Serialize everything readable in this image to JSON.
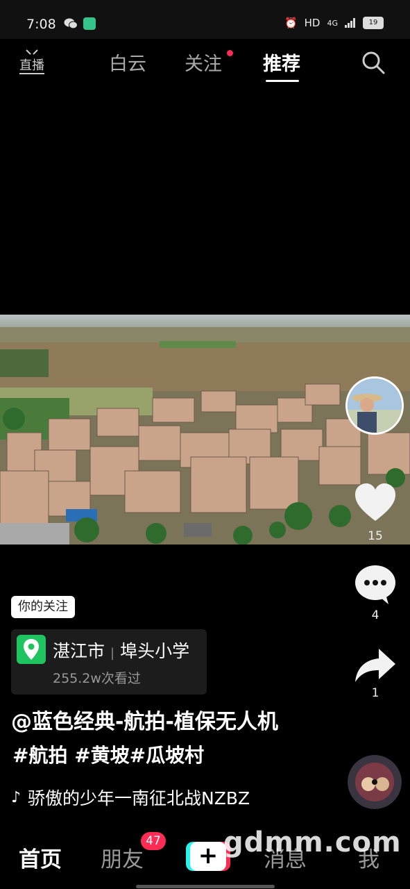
{
  "status_bar": {
    "time": "7:08",
    "network": "HD",
    "signal": "4G",
    "battery": "19"
  },
  "top_nav": {
    "live_label": "直播",
    "tabs": [
      {
        "label": "白云",
        "active": false
      },
      {
        "label": "关注",
        "active": false,
        "has_dot": true
      },
      {
        "label": "推荐",
        "active": true
      }
    ]
  },
  "right_rail": {
    "likes": "15",
    "comments": "4",
    "shares": "1"
  },
  "info": {
    "follow_tag": "你的关注",
    "location": {
      "city": "湛江市",
      "place": "埠头小学",
      "views": "255.2w次看过"
    },
    "author": "@蓝色经典-航拍-植保无人机",
    "hashtags": "#航拍 #黄坡#瓜坡村",
    "music": "骄傲的少年一南征北战NZBZ"
  },
  "bottom_nav": {
    "home": "首页",
    "friends": "朋友",
    "friends_badge": "47",
    "messages": "消息",
    "me": "我"
  },
  "watermark": "gdmm.com",
  "colors": {
    "accent_red": "#fe2c55",
    "accent_cyan": "#25f4ee",
    "location_green": "#1fc35f"
  }
}
